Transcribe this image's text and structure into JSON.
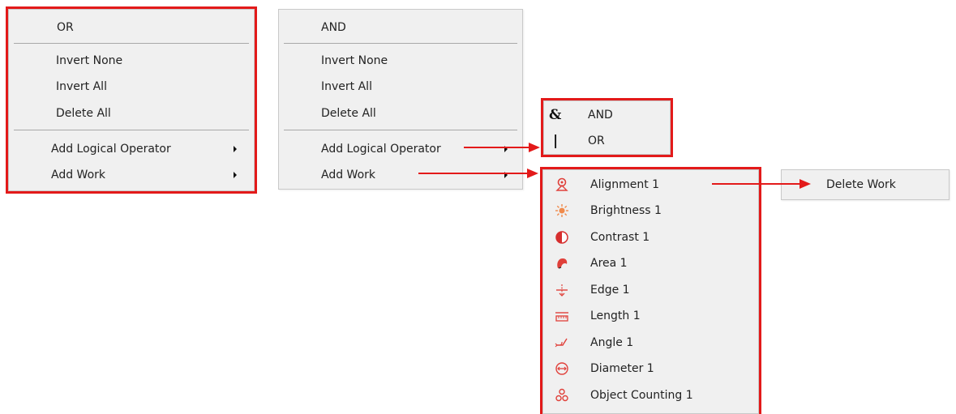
{
  "menu_or": {
    "header": "OR",
    "items": [
      "Invert None",
      "Invert All",
      "Delete All"
    ],
    "submenus": [
      "Add Logical Operator",
      "Add Work"
    ]
  },
  "menu_and": {
    "header": "AND",
    "items": [
      "Invert None",
      "Invert All",
      "Delete All"
    ],
    "submenus": [
      "Add Logical Operator",
      "Add Work"
    ]
  },
  "logical_operator_menu": [
    {
      "glyph": "&",
      "label": "AND",
      "icon": "ampersand-icon"
    },
    {
      "glyph": "|",
      "label": "OR",
      "icon": "pipe-icon"
    }
  ],
  "work_menu": [
    {
      "label": "Alignment 1",
      "icon": "alignment-icon"
    },
    {
      "label": "Brightness 1",
      "icon": "brightness-icon"
    },
    {
      "label": "Contrast 1",
      "icon": "contrast-icon"
    },
    {
      "label": "Area 1",
      "icon": "area-icon"
    },
    {
      "label": "Edge 1",
      "icon": "edge-icon"
    },
    {
      "label": "Length 1",
      "icon": "length-icon"
    },
    {
      "label": "Angle 1",
      "icon": "angle-icon"
    },
    {
      "label": "Diameter 1",
      "icon": "diameter-icon"
    },
    {
      "label": "Object Counting 1",
      "icon": "object-counting-icon"
    }
  ],
  "work_context_menu": {
    "delete_label": "Delete Work"
  },
  "colors": {
    "highlight": "#e31a1a",
    "menu_bg": "#f0f0f0",
    "icon_red": "#e0403a"
  }
}
